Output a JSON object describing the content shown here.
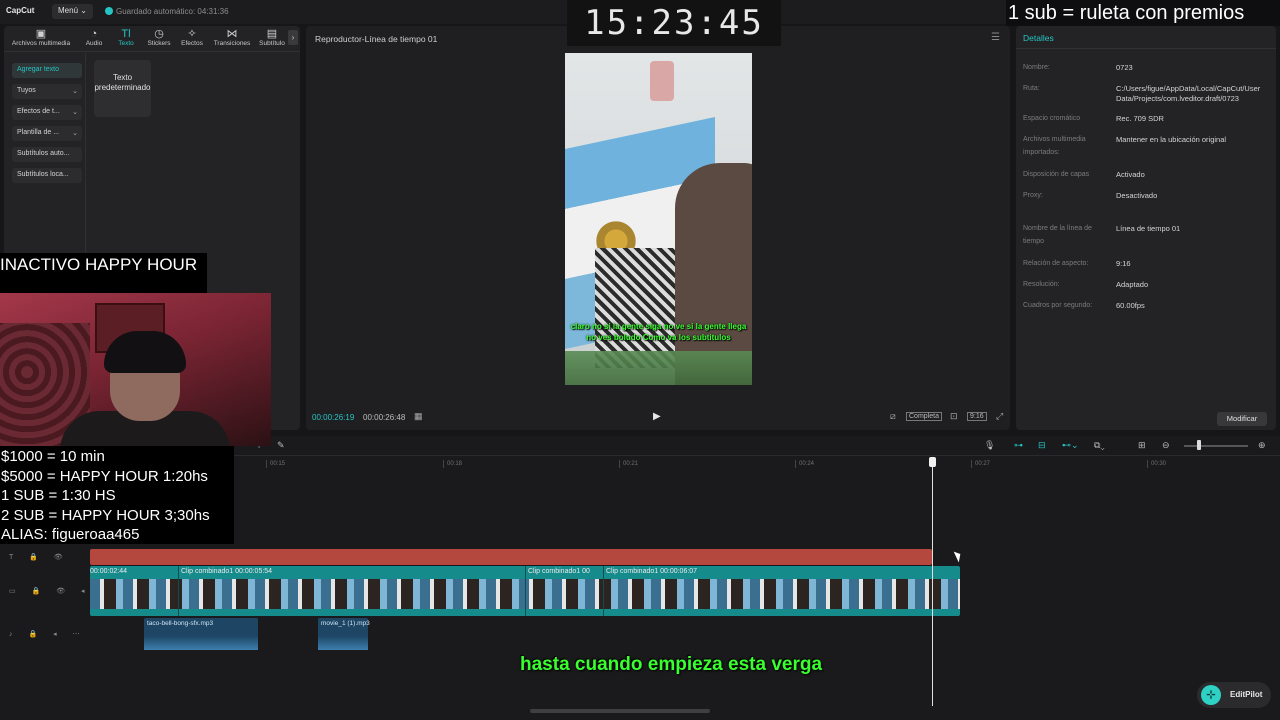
{
  "app": {
    "logo": "CapCut",
    "menu_label": "Menú",
    "autosave": "Guardado automático: 04:31:36"
  },
  "media_tabs": [
    {
      "label": "Archivos multimedia",
      "icon": "media-icon"
    },
    {
      "label": "Audio",
      "icon": "audio-icon"
    },
    {
      "label": "Texto",
      "icon": "text-icon"
    },
    {
      "label": "Stickers",
      "icon": "stickers-icon"
    },
    {
      "label": "Efectos",
      "icon": "effects-icon"
    },
    {
      "label": "Transiciones",
      "icon": "transitions-icon"
    },
    {
      "label": "Subtítulo",
      "icon": "subtitles-icon"
    }
  ],
  "text_sidebar": [
    "Agregar texto",
    "Tuyos",
    "Efectos de t...",
    "Plantilla de ...",
    "Subtítulos auto...",
    "Subtítulos loca..."
  ],
  "default_text_card": "Texto predeterminado",
  "player": {
    "title": "Reproductor-Línea de tiempo 01",
    "caption_line1": "claro no si la gente siga no ve si la gente llega",
    "caption_line2": "no ves boludo Como va los subtitulos",
    "time_current": "00:00:26:19",
    "time_total": "00:00:26:48",
    "full_label": "Completa",
    "ratio_label": "9:16"
  },
  "details": {
    "title": "Detalles",
    "rows": [
      {
        "label": "Nombre:",
        "value": "0723"
      },
      {
        "label": "Ruta:",
        "value": "C:/Users/figue/AppData/Local/CapCut/User Data/Projects/com.lveditor.draft/0723"
      },
      {
        "label": "Espacio cromático",
        "value": "Rec. 709 SDR"
      },
      {
        "label": "Archivos multimedia importados:",
        "value": "Mantener en la ubicación original"
      },
      {
        "label": "Disposición de capas",
        "value": "Activado"
      },
      {
        "label": "Proxy:",
        "value": "Desactivado"
      },
      {
        "label": "Nombre de la línea de tiempo",
        "value": "Línea de tiempo 01"
      },
      {
        "label": "Relación de aspecto:",
        "value": "9:16"
      },
      {
        "label": "Resolución:",
        "value": "Adaptado"
      },
      {
        "label": "Cuadros por segundo:",
        "value": "60.00fps"
      }
    ],
    "modify_label": "Modificar"
  },
  "timeline": {
    "ruler": [
      "00:15",
      "00:18",
      "00:21",
      "00:24",
      "00:27",
      "00:30"
    ],
    "clip_start": "00:00:02:44",
    "clips": [
      {
        "label": "Clip combinado1  00:00:05:54"
      },
      {
        "label": "Clip combinado1  00"
      },
      {
        "label": "Clip combinado1  00:00:06:07"
      }
    ],
    "audio_clips": [
      "taco-bell-bong-sfx.mp3",
      "movie_1 (1).mp3"
    ],
    "bottom_caption": "hasta cuando empieza esta verga",
    "editpilot_label": "EditPilot"
  },
  "overlays": {
    "clock": "15:23:45",
    "sub_banner": "1 sub = ruleta con premios",
    "happy_hour": "INACTIVO HAPPY HOUR",
    "donations": [
      "$1000 = 10 min",
      "$5000 = HAPPY HOUR 1:20hs",
      "1 SUB = 1:30 HS",
      "2 SUB = HAPPY HOUR 3;30hs",
      "ALIAS: figueroaa465"
    ]
  },
  "colors": {
    "accent": "#25c4c4",
    "caption_green": "#39ff2e",
    "text_track": "#b4473e",
    "video_track": "#168b8b"
  }
}
